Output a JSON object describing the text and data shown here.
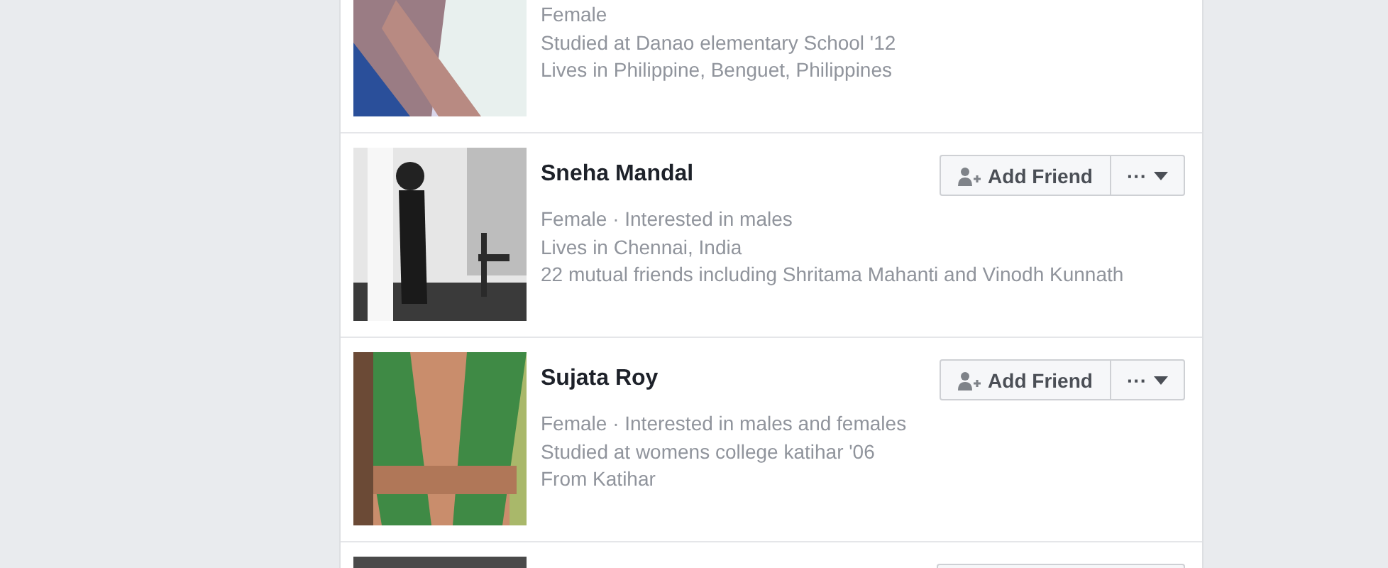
{
  "results": [
    {
      "details": [
        "Female",
        "Studied at Danao elementary School '12",
        "Lives in Philippine, Benguet, Philippines"
      ]
    },
    {
      "name": "Sneha Mandal",
      "details": [
        "Female · Interested in males",
        "Lives in Chennai, India",
        "22 mutual friends including Shritama Mahanti and Vinodh Kunnath"
      ],
      "actions": {
        "add_friend": "Add Friend",
        "more": "···"
      }
    },
    {
      "name": "Sujata Roy",
      "details": [
        "Female · Interested in males and females",
        "Studied at womens college katihar '06",
        "From Katihar"
      ],
      "actions": {
        "add_friend": "Add Friend",
        "more": "···"
      }
    }
  ]
}
